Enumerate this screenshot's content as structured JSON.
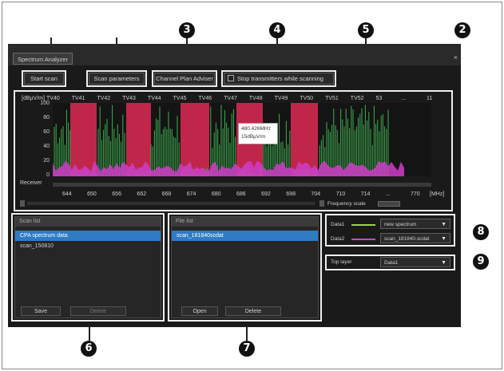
{
  "window": {
    "tab_title": "Spectrum Analyzer",
    "close_glyph": "×"
  },
  "toolbar": {
    "start_scan": "Start scan",
    "scan_parameters": "Scan parameters",
    "channel_plan_advisor": "Channel Plan Adviser",
    "stop_transmitters": "Stop transmitters while scanning"
  },
  "callouts": {
    "c2": "2",
    "c3": "3",
    "c4": "4",
    "c5": "5",
    "c6": "6",
    "c7": "7",
    "c8": "8",
    "c9": "9"
  },
  "chart": {
    "ylabel": "[dBµV/m]",
    "channels": [
      "TV40",
      "TV41",
      "TV42",
      "TV43",
      "TV44",
      "TV45",
      "TV46",
      "TV47",
      "TV48",
      "TV49",
      "TV50",
      "TV51",
      "TV52",
      "53",
      "...",
      "11"
    ],
    "y_ticks": [
      "100",
      "80",
      "60",
      "40",
      "20",
      "0"
    ],
    "x_ticks": [
      "644",
      "650",
      "656",
      "662",
      "668",
      "674",
      "680",
      "686",
      "692",
      "698",
      "704",
      "710",
      "714",
      "...",
      "770"
    ],
    "x_unit": "[MHz]",
    "receiver_label": "Receiver",
    "tooltip_line1": "480.426MHz",
    "tooltip_line2": "15dBµV/m",
    "frequency_scale_label": "Frequency scale",
    "colors": {
      "occupied": "#c0264a",
      "bars": "#3fae4f",
      "noise": "#d03cc8",
      "background": "#141414"
    }
  },
  "scan_list": {
    "title": "Scan list",
    "items": [
      "CPA spectrum data",
      "scan_150810"
    ],
    "selected_index": 0,
    "save_label": "Save",
    "delete_label": "Delete"
  },
  "file_list": {
    "title": "File list",
    "items": [
      "scan_181840scdat"
    ],
    "selected_index": 0,
    "open_label": "Open",
    "delete_label": "Delete"
  },
  "data_legend": {
    "data1_label": "Data1",
    "data1_value": "new spectrum",
    "data1_color": "#9fd24a",
    "data2_label": "Data2",
    "data2_value": "scan_181840.scdat",
    "data2_color": "#c64ac4"
  },
  "top_layer": {
    "label": "Top layer",
    "value": "Data1"
  }
}
